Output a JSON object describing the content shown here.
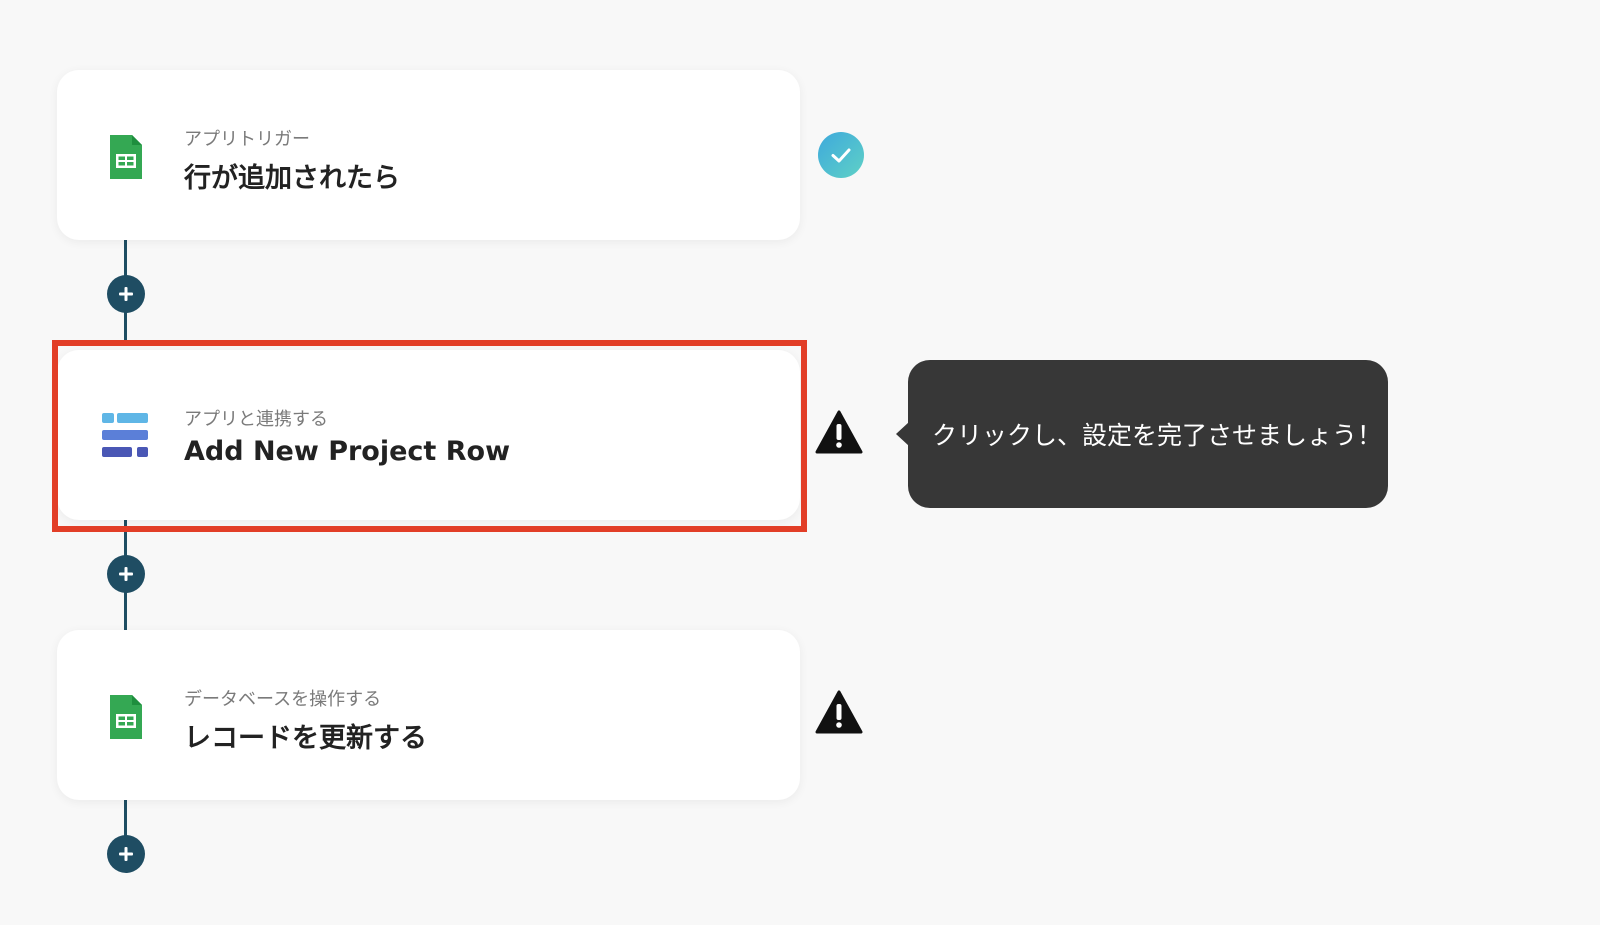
{
  "steps": [
    {
      "subtitle": "アプリトリガー",
      "title": "行が追加されたら",
      "icon": "google-sheets-icon",
      "status": "complete"
    },
    {
      "subtitle": "アプリと連携する",
      "title": "Add New Project Row",
      "icon": "database-app-icon",
      "status": "warning"
    },
    {
      "subtitle": "データベースを操作する",
      "title": "レコードを更新する",
      "icon": "google-sheets-icon",
      "status": "warning"
    }
  ],
  "tooltip": {
    "text": "クリックし、設定を完了させましょう！"
  },
  "colors": {
    "background": "#f8f8f8",
    "connector": "#1e4e63",
    "highlight": "#e23e27",
    "tooltip": "#373737",
    "sheets_green": "#34a853",
    "check_start": "#3ea9dc",
    "check_end": "#5fd1c6"
  }
}
